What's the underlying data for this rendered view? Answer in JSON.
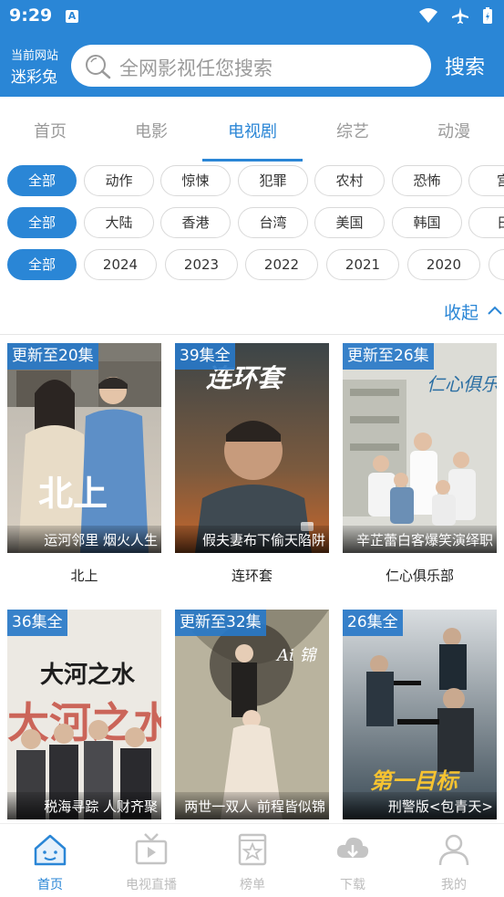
{
  "status_bar": {
    "time": "9:29"
  },
  "header": {
    "site_label": "当前网站",
    "site_name": "迷彩兔",
    "search_placeholder": "全网影视任您搜索",
    "search_button": "搜索"
  },
  "tabs": [
    {
      "label": "首页"
    },
    {
      "label": "电影"
    },
    {
      "label": "电视剧"
    },
    {
      "label": "综艺"
    },
    {
      "label": "动漫"
    }
  ],
  "filters": {
    "genre": [
      "全部",
      "动作",
      "惊悚",
      "犯罪",
      "农村",
      "恐怖",
      "宫"
    ],
    "region": [
      "全部",
      "大陆",
      "香港",
      "台湾",
      "美国",
      "韩国",
      "日"
    ],
    "year": [
      "全部",
      "2024",
      "2023",
      "2022",
      "2021",
      "2020",
      ""
    ]
  },
  "collapse_label": "收起",
  "shows": [
    {
      "badge": "更新至20集",
      "caption": "运河邻里 烟火人生",
      "title": "北上",
      "poster_text": "北上"
    },
    {
      "badge": "39集全",
      "caption": "假夫妻布下偷天陷阱",
      "title": "连环套",
      "poster_text": "连环套"
    },
    {
      "badge": "更新至26集",
      "caption": "辛芷蕾白客爆笑演绎职",
      "title": "仁心俱乐部",
      "poster_text": "仁心俱乐部"
    },
    {
      "badge": "36集全",
      "caption": "税海寻踪 人财齐聚",
      "title": "",
      "poster_text": "大河之水"
    },
    {
      "badge": "更新至32集",
      "caption": "两世一双人 前程皆似锦",
      "title": "",
      "poster_text": ""
    },
    {
      "badge": "26集全",
      "caption": "刑警版<包青天>",
      "title": "",
      "poster_text": "第一目标"
    }
  ],
  "bottom_nav": [
    {
      "label": "首页",
      "icon": "home-icon"
    },
    {
      "label": "电视直播",
      "icon": "tv-icon"
    },
    {
      "label": "榜单",
      "icon": "ranking-icon"
    },
    {
      "label": "下载",
      "icon": "download-icon"
    },
    {
      "label": "我的",
      "icon": "profile-icon"
    }
  ],
  "colors": {
    "accent": "#2a86d6",
    "inactive": "#9a9a9a"
  }
}
